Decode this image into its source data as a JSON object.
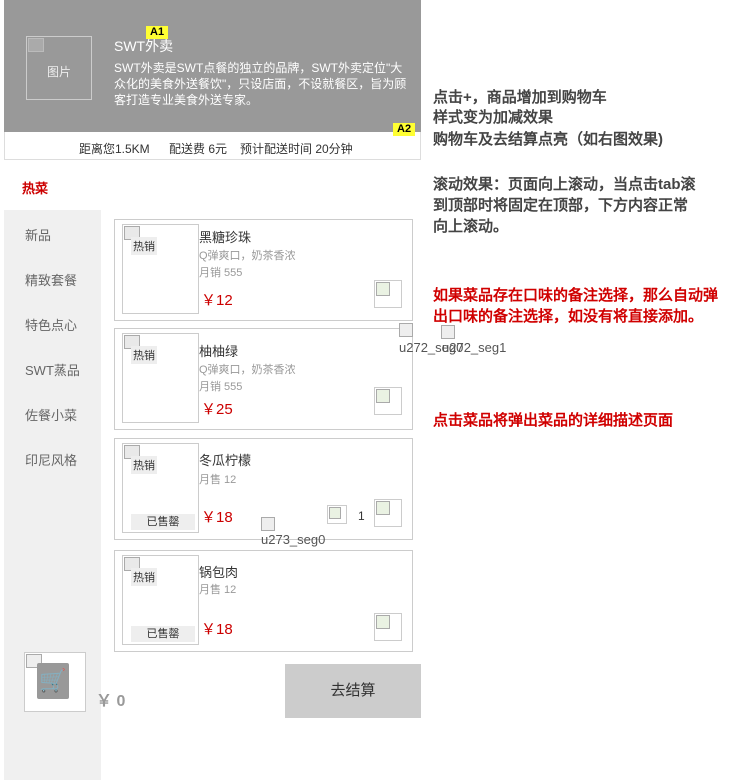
{
  "header": {
    "image_label": "图片",
    "title": "SWT外卖",
    "desc": "SWT外卖是SWT点餐的独立的品牌，SWT外卖定位\"大众化的美食外送餐饮\"，只设店面，不设就餐区，旨为顾客打造专业美食外送专家。",
    "badge_a1": "A1",
    "badge_a2": "A2"
  },
  "info": {
    "distance": "距离您1.5KM",
    "fee": "配送费 6元",
    "time": "预计配送时间 20分钟"
  },
  "tabs": {
    "active": "热菜",
    "categories": [
      "新品",
      "精致套餐",
      "特色点心",
      "SWT蒸品",
      "佐餐小菜",
      "印尼风格"
    ]
  },
  "products": [
    {
      "name": "黑糖珍珠",
      "tag": "热销",
      "desc": "Q弹爽口，奶茶香浓",
      "sales": "月销 555",
      "price": "￥12"
    },
    {
      "name": "柚柚绿",
      "tag": "热销",
      "desc": "Q弹爽口，奶茶香浓",
      "sales": "月销 555",
      "price": "￥25"
    },
    {
      "name": "冬瓜柠檬",
      "tag": "热销",
      "sales": "月售 12",
      "price": "￥18",
      "status": "已售罄",
      "qty": "1"
    },
    {
      "name": "锅包肉",
      "tag": "热销",
      "sales": "月售 12",
      "price": "￥18",
      "status": "已售罄"
    }
  ],
  "segments": {
    "u272_a": "u272_seg0",
    "u272_b": "u272_seg1",
    "u273": "u273_seg0"
  },
  "cart": {
    "total": "￥ 0",
    "checkout": "去结算"
  },
  "notes": {
    "n1": "点击+，商品增加到购物车",
    "n2": "样式变为加减效果",
    "n3": "购物车及去结算点亮（如右图效果)",
    "n4": "滚动效果：页面向上滚动，当点击tab滚",
    "n5": "到顶部时将固定在顶部，下方内容正常",
    "n6": "向上滚动。",
    "n7": "如果菜品存在口味的备注选择，那么自动弹",
    "n8": "出口味的备注选择，如没有将直接添加。",
    "n9": "点击菜品将弹出菜品的详细描述页面"
  },
  "colors": {
    "accent": "#cc0000",
    "header_bg": "#999999",
    "badge": "#ffff33"
  }
}
